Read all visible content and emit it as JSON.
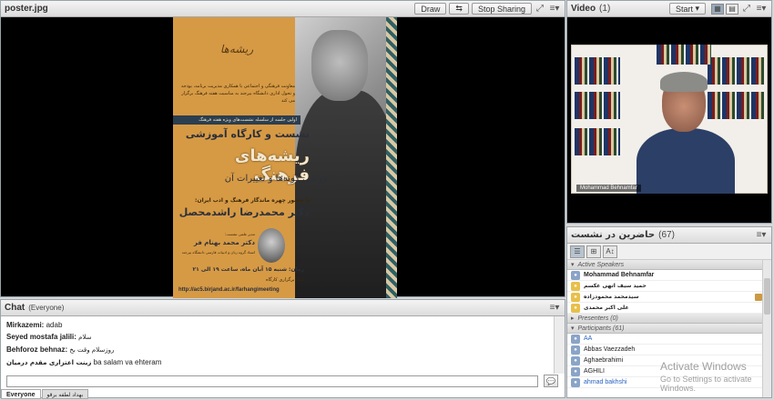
{
  "share": {
    "title": "poster.jpg",
    "draw_label": "Draw",
    "stop_sharing_label": "Stop Sharing",
    "poster": {
      "logo_text": "ریشه‌ها",
      "intro": "معاونت فرهنگی و اجتماعی با همکاری مدیریت برنامه، بودجه و تحول اداری دانشگاه بیرجند به مناسبت هفته فرهنگ برگزار می کند",
      "band": "اولین جلسه از سلسله نشست‌های ویژه هفته فرهنگ",
      "title_line1": "نشست و کارگاه آموزشی",
      "title_line2": "ریشه‌های فرهنگ",
      "title_line3": "بررسی گونه‌ها و تغییرات آن",
      "guest_intro": "با حضور چهره ماندگار فرهنگ و ادب ایران:",
      "guest_name": "دکتر محمدرضا راشدمحصل",
      "moderator_label": "مدیر علمی نشست:",
      "moderator_name": "دکتر محمد بهنام فر",
      "moderator_desc": "استاد گروه زبان و ادبیات فارسی دانشگاه بیرجند",
      "time": "زمان: شنبه ۱۵ آبان ماه، ساعت ۱۹ الی ۲۱",
      "place": "لینک برگزاری کارگاه",
      "url": "http://ac5.birjand.ac.ir/farhangimeeting"
    }
  },
  "video": {
    "title": "Video",
    "count": "(1)",
    "start_label": "Start",
    "speaker_name": "Mohammad Behnamfar"
  },
  "attendees": {
    "title": "حاضرین در نشست",
    "count": "(67)",
    "active_speakers_label": "Active Speakers",
    "active_speakers": [
      {
        "name": "Mohammad Behnamfar"
      },
      {
        "name": "حمید سیف اتهی عکسم"
      },
      {
        "name": "سیدمحمد محمودزاده"
      },
      {
        "name": "علی اکبر محمدی"
      }
    ],
    "presenters_label": "Presenters (0)",
    "participants_label": "Participants (61)",
    "participants": [
      {
        "name": "AA"
      },
      {
        "name": "Abbas Vaezzadeh"
      },
      {
        "name": "Aghaebrahimi"
      },
      {
        "name": "AGHILI"
      },
      {
        "name": "ahmad bakhshi"
      }
    ]
  },
  "chat": {
    "title": "Chat",
    "scope": "(Everyone)",
    "messages": [
      {
        "who": "Mirkazemi:",
        "text": "adab"
      },
      {
        "who": "Seyed mostafa jalili:",
        "text": "سلام"
      },
      {
        "who": "Behforoz behnaz:",
        "text": "روزسلام وقت بخ"
      },
      {
        "who": "زینت اعتزاری مقدم درمیان",
        "text": "ba salam va ehteram"
      }
    ],
    "tab_everyone": "Everyone",
    "tab_private": "بهداد لطفه برقو"
  },
  "watermark": {
    "line1": "Activate Windows",
    "line2": "Go to Settings to activate Windows."
  }
}
